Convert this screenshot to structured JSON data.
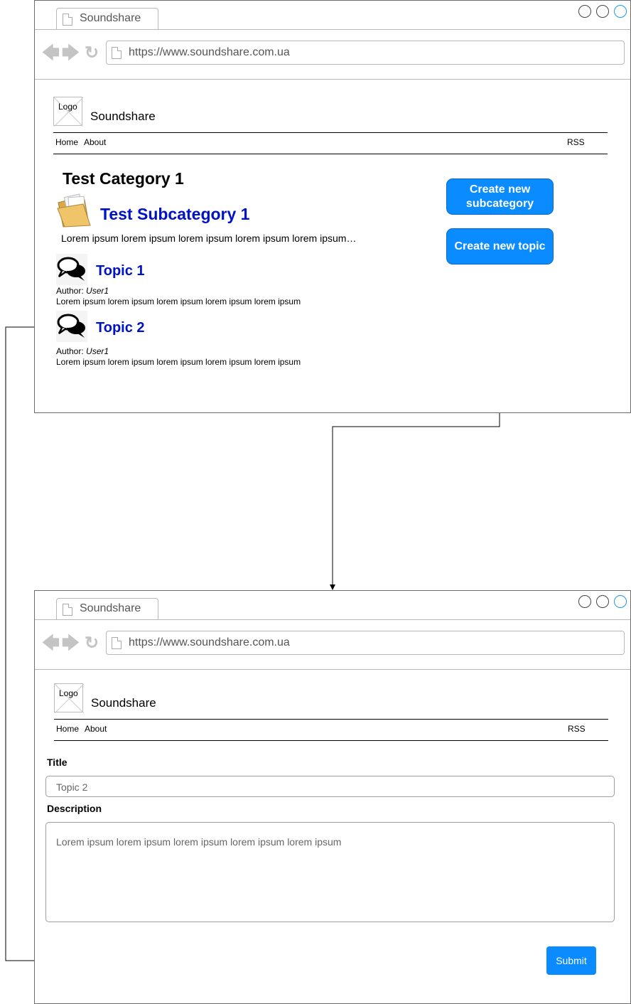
{
  "browser_top": {
    "tab_title": "Soundshare",
    "url": "https://www.soundshare.com.ua",
    "site": {
      "logo_text": "Logo",
      "name": "Soundshare"
    },
    "menu": {
      "home": "Home",
      "about": "About",
      "rss": "RSS"
    },
    "category_title": "Test Category 1",
    "subcategory": {
      "title": "Test Subcategory 1",
      "description": "Lorem ipsum lorem ipsum lorem ipsum lorem ipsum lorem ipsum…"
    },
    "topics": [
      {
        "title": "Topic 1",
        "author_label": "Author:",
        "author": "User1",
        "text": "Lorem ipsum lorem ipsum lorem ipsum lorem ipsum lorem ipsum"
      },
      {
        "title": "Topic 2",
        "author_label": "Author:",
        "author": "User1",
        "text": "Lorem ipsum lorem ipsum lorem ipsum lorem ipsum lorem ipsum"
      }
    ],
    "buttons": {
      "create_subcategory_line1": "Create new",
      "create_subcategory_line2": "subcategory",
      "create_topic": "Create new topic"
    }
  },
  "browser_bottom": {
    "tab_title": "Soundshare",
    "url": "https://www.soundshare.com.ua",
    "site": {
      "logo_text": "Logo",
      "name": "Soundshare"
    },
    "menu": {
      "home": "Home",
      "about": "About",
      "rss": "RSS"
    },
    "form": {
      "title_label": "Title",
      "title_value": "Topic 2",
      "description_label": "Description",
      "description_value": "Lorem ipsum lorem ipsum lorem ipsum lorem ipsum lorem ipsum",
      "submit_label": "Submit"
    }
  },
  "colors": {
    "button_blue": "#0a8bff",
    "link_blue": "#0012c8",
    "window_border": "#6b6b6b"
  }
}
